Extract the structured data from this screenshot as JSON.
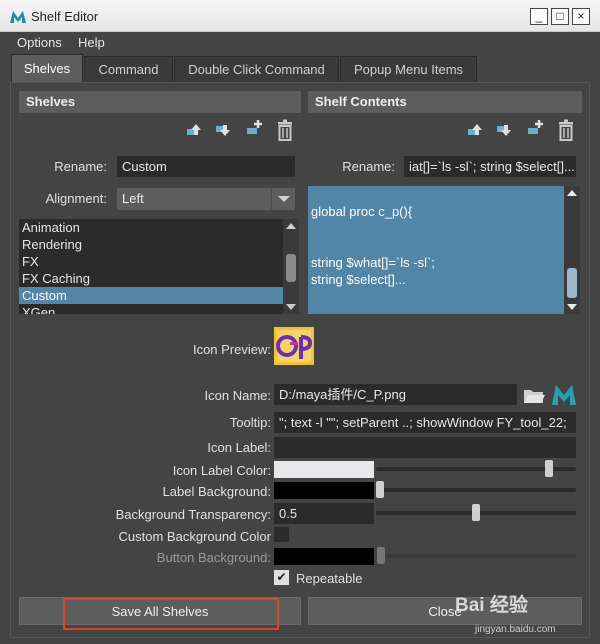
{
  "window": {
    "title": "Shelf Editor",
    "minimize_glyph": "_",
    "maximize_glyph": "□",
    "close_glyph": "×"
  },
  "menu": {
    "options": "Options",
    "help": "Help"
  },
  "tabs": [
    {
      "label": "Shelves",
      "active": true
    },
    {
      "label": "Command",
      "active": false
    },
    {
      "label": "Double Click Command",
      "active": false
    },
    {
      "label": "Popup Menu Items",
      "active": false
    }
  ],
  "shelves_panel": {
    "header": "Shelves",
    "rename_label": "Rename:",
    "rename_value": "Custom",
    "alignment_label": "Alignment:",
    "alignment_value": "Left",
    "items": [
      "Animation",
      "Rendering",
      "FX",
      "FX Caching",
      "Custom",
      "XGen"
    ],
    "selected_item": "Custom"
  },
  "shelf_contents_panel": {
    "header": "Shelf Contents",
    "rename_label": "Rename:",
    "rename_value": "iat[]=`ls -sl`; string $select[]...",
    "code_lines": [
      "",
      "global proc  c_p(){",
      "",
      "",
      "string $what[]=`ls -sl`;",
      "string $select[]..."
    ]
  },
  "properties": {
    "icon_preview_label": "Icon Preview:",
    "icon_name_label": "Icon Name:",
    "icon_name_value": "D:/maya插件/C_P.png",
    "tooltip_label": "Tooltip:",
    "tooltip_value": "\"; text -l \"\"; setParent ..;     showWindow FY_tool_22;",
    "icon_label_label": "Icon Label:",
    "icon_label_value": "",
    "icon_label_color_label": "Icon Label Color:",
    "icon_label_color": "#e8e8ea",
    "icon_label_color_level": 0.88,
    "label_background_label": "Label Background:",
    "label_background_color": "#000000",
    "label_background_level": 0.0,
    "background_transparency_label": "Background Transparency:",
    "background_transparency_value": "0.5",
    "custom_background_color_label": "Custom Background Color",
    "custom_background_checked": false,
    "button_background_label": "Button Background:",
    "button_background_color": "#000000",
    "repeatable_label": "Repeatable",
    "repeatable_checked": true
  },
  "buttons": {
    "save_all": "Save All Shelves",
    "close": "Close"
  },
  "watermark": {
    "text": "Bai 经验",
    "url": "jingyan.baidu.com"
  },
  "colors": {
    "accent": "#5285a6",
    "panel": "#444444",
    "highlight": "#d9442c"
  },
  "icons": [
    "maya-app-icon",
    "move-up-icon",
    "move-down-icon",
    "new-shelf-icon",
    "delete-icon",
    "folder-icon",
    "maya-icon",
    "cp-icon"
  ]
}
